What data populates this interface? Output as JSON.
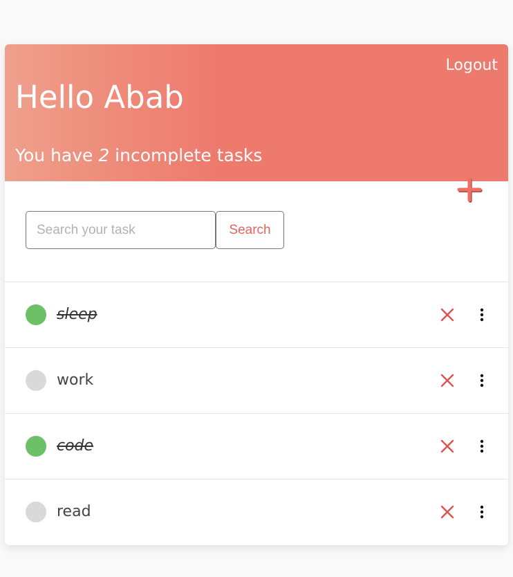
{
  "header": {
    "logout_label": "Logout",
    "greeting": "Hello Abab",
    "summary_prefix": "You have ",
    "incomplete_count": "2",
    "summary_suffix": " incomplete tasks"
  },
  "toolbar": {
    "search_placeholder": "Search your task",
    "search_value": "",
    "search_button_label": "Search",
    "add_icon": "plus-icon"
  },
  "tasks": [
    {
      "name": "sleep",
      "done": true
    },
    {
      "name": "work",
      "done": false
    },
    {
      "name": "code",
      "done": true
    },
    {
      "name": "read",
      "done": false
    }
  ],
  "colors": {
    "header_gradient_start": "#eea08c",
    "header_gradient_end": "#ee7a6e",
    "accent": "#e0655a",
    "done": "#6cc065",
    "todo": "#d9d9d9",
    "delete": "#d9534f"
  }
}
